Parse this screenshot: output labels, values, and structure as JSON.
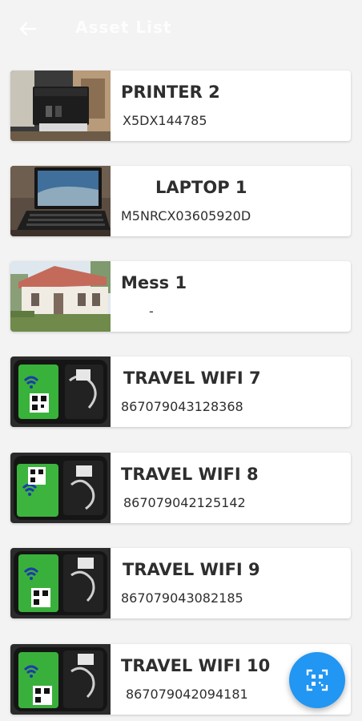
{
  "appbar": {
    "title": "Asset List",
    "back_icon": "arrow-left-icon"
  },
  "items": [
    {
      "title": "PRINTER 2",
      "subtitle": "X5DX144785",
      "image": "printer-photo"
    },
    {
      "title": "LAPTOP 1",
      "subtitle": "M5NRCX03605920D",
      "image": "laptop-photo"
    },
    {
      "title": "Mess 1",
      "subtitle": "-",
      "image": "house-photo"
    },
    {
      "title": "TRAVEL WIFI 7",
      "subtitle": "867079043128368",
      "image": "travel-wifi-photo"
    },
    {
      "title": "TRAVEL WIFI 8",
      "subtitle": "867079042125142",
      "image": "travel-wifi-photo"
    },
    {
      "title": "TRAVEL WIFI 9",
      "subtitle": "867079043082185",
      "image": "travel-wifi-photo"
    },
    {
      "title": "TRAVEL WIFI 10",
      "subtitle": "867079042094181",
      "image": "travel-wifi-photo"
    }
  ],
  "fab": {
    "icon": "qr-scan-icon",
    "color": "#2196f3"
  }
}
